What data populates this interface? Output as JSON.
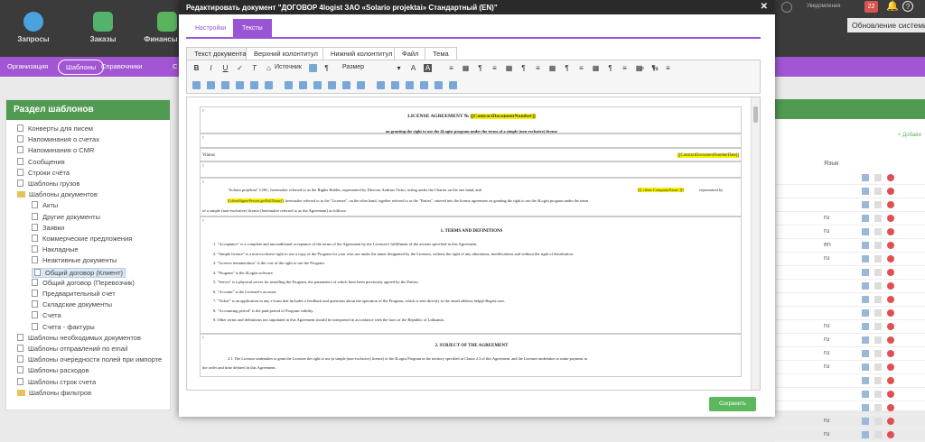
{
  "topnav": {
    "items": [
      {
        "label": "Запросы",
        "color": "#4aa3df"
      },
      {
        "label": "Заказы",
        "color": "#53b36c"
      },
      {
        "label": "Финансы",
        "color": "#5ab45e"
      }
    ],
    "notifications_label": "Уведомления",
    "notif_count": "22",
    "tooltip": "Обновление системы"
  },
  "subnav": {
    "items": [
      "Организация",
      "Шаблоны",
      "Справочники",
      "С"
    ]
  },
  "left": {
    "title": "Раздел шаблонов",
    "items": [
      {
        "label": "Конверты для писем",
        "level": 0,
        "type": "file"
      },
      {
        "label": "Напоминания о счетах",
        "level": 0,
        "type": "file"
      },
      {
        "label": "Напоминания о CMR",
        "level": 0,
        "type": "file"
      },
      {
        "label": "Сообщения",
        "level": 0,
        "type": "file"
      },
      {
        "label": "Строки счёта",
        "level": 0,
        "type": "file"
      },
      {
        "label": "Шаблоны грузов",
        "level": 0,
        "type": "file"
      },
      {
        "label": "Шаблоны документов",
        "level": 0,
        "type": "folder"
      },
      {
        "label": "Акты",
        "level": 1,
        "type": "file"
      },
      {
        "label": "Другие документы",
        "level": 1,
        "type": "file"
      },
      {
        "label": "Заявки",
        "level": 1,
        "type": "file"
      },
      {
        "label": "Коммерческие предложения",
        "level": 1,
        "type": "file"
      },
      {
        "label": "Накладные",
        "level": 1,
        "type": "file"
      },
      {
        "label": "Неактивные документы",
        "level": 1,
        "type": "file"
      },
      {
        "label": "Общий договор (Клиент)",
        "level": 1,
        "type": "file",
        "selected": true
      },
      {
        "label": "Общий договор (Перевозчик)",
        "level": 1,
        "type": "file"
      },
      {
        "label": "Предварительный счет",
        "level": 1,
        "type": "file"
      },
      {
        "label": "Складские документы",
        "level": 1,
        "type": "file"
      },
      {
        "label": "Счета",
        "level": 1,
        "type": "file"
      },
      {
        "label": "Счета - фактуры",
        "level": 1,
        "type": "file"
      },
      {
        "label": "Шаблоны необходимых документов",
        "level": 0,
        "type": "file"
      },
      {
        "label": "Шаблоны отправлений по email",
        "level": 0,
        "type": "file"
      },
      {
        "label": "Шаблоны очередности полей при импорте",
        "level": 0,
        "type": "file"
      },
      {
        "label": "Шаблоны расходов",
        "level": 0,
        "type": "file"
      },
      {
        "label": "Шаблоны строк счета",
        "level": 0,
        "type": "file"
      },
      {
        "label": "Шаблоны фильтров",
        "level": 0,
        "type": "folder"
      }
    ]
  },
  "right": {
    "add_label": "+ Добави",
    "col_lang": "Язык",
    "rows": [
      "",
      "",
      "",
      "ru",
      "ru",
      "en",
      "ru",
      "",
      "",
      "",
      "",
      "ru",
      "ru",
      "ru",
      "ru",
      "",
      "",
      "",
      "ru",
      "ru"
    ]
  },
  "modal": {
    "title": "Редактировать документ \"ДОГОВОР 4logist ЗАО «Solario projektai» Стандартный (EN)\"",
    "close": "✕",
    "tabs": [
      "Настройки",
      "Тексты"
    ],
    "doc_tabs": [
      "Текст документа",
      "Верхний колонтитул",
      "Нижний колонтитул",
      "Файл",
      "Тема"
    ],
    "source_label": "Источник",
    "size_label": "Размер",
    "save_label": "Сохранить",
    "doc": {
      "title": "LICENSE AGREEMENT № ",
      "title_tag": "[[ContractDocumentNumber]]",
      "subtitle": "on granting the right to use the 4Logist program under the terms of a simple (non-exclusive) license",
      "city": "Vilnius",
      "date_tag": "[[ContractDocumentNumberDate]]",
      "p_mark": "P",
      "intro_1": "\"Solario projektai\" CJSC, hereinafter referred to as the Rights Holder, represented by Director Andrius Vicko, acting under the Charter on the one hand, and",
      "intro_tag1": "[[[ client.CompanyName ]]]",
      "intro_2": "represented by",
      "intro_tag2": "[[clientSignerPerson.getFullName]]",
      "intro_3": ", hereinafter referred to as the \"Licensee\", on the other hand, together referred to as the \"Parties\", entered into the license agreement on granting the right to use the 4Logist program under the terms",
      "intro_4": "of a simple (non-exclusive) license (hereinafter referred to as the Agreement) as follows:",
      "sec1": "1. TERMS AND DEFINITIONS",
      "defs": [
        "1. \"Acceptance\" is a complete and unconditional acceptance of the terms of the Agreement by the Licensee's fulfillment of the actions specified in this Agreement.",
        "2. \"Simple licence\" is a non-exclusive right to use a copy of the Program for your own use under the name designated by the Licensor, without the right of any alterations, modifications and without the right of distribution.",
        "3. \"Licence remuneration\" is the cost of the right to use the Program.",
        "4. \"Program\" is the 4Logist software.",
        "5. \"Server\" is a physical server for installing the Program, the parameters of which have been previously agreed by the Parties.",
        "6. \"Account\" is the Licensee's account.",
        "7. \"Ticket\" is an application in any e-form that includes a feedback and questions about the operation of the Program, which is sent directly to the email address help@4logist.com.",
        "8. \"Accounting period\" is the paid period of Program validity.",
        "9. Other terms and definitions not stipulated in this Agreement should be interpreted in accordance with the laws of the Republic of Lithuania."
      ],
      "sec2": "2. SUBJECT OF THE AGREEMENT",
      "s2_1": "2.1. The Licensor undertakes to grant the Licensee the right to use (a simple (non-exclusive) license) of the 4Logist Program in the territory specified in Clause 2.3 of this Agreement, and the Licensee undertakes to make payment in",
      "s2_2": "the order and time defined in this Agreement."
    }
  }
}
